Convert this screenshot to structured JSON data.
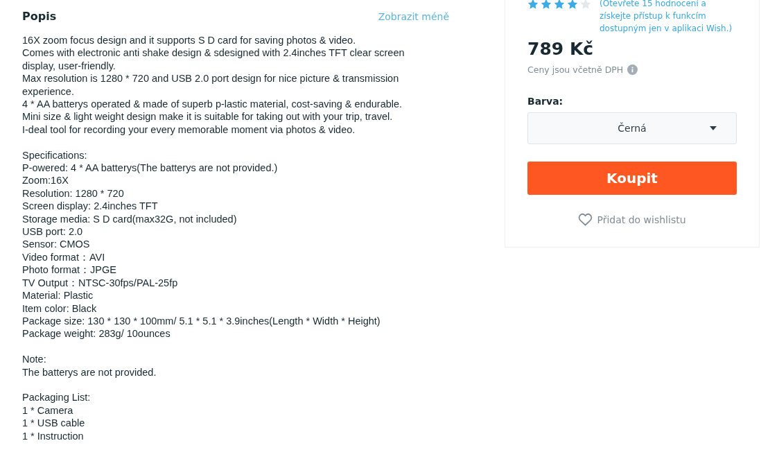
{
  "description": {
    "title": "Popis",
    "toggle_link": "Zobrazit méně",
    "blocks": [
      [
        "16X zoom focus design and it supports S D card for saving photos & video.",
        "Comes with electronic anti shake design & sdesigned with 2.4inches TFT clear screen display, user-friendly.",
        "Max resolution is 1280 * 720 and USB 2.0 port design for nice picture & transmission experience.",
        "4 * AA batterys operated & made of superb p-lastic material, cost-saving & endurable.",
        "Mini size & light weight design make it is suitable for taking out with your trip, travel.",
        "I-deal tool for recording your every memorable moment via photos & video."
      ],
      [
        "Specifications:",
        "P-owered: 4 * AA batterys(The batterys are not provided.)",
        "Zoom:16X",
        "Resolution: 1280 * 720",
        "Screen display: 2.4inches TFT",
        "Storage media: S D card(max32G, not included)",
        "USB port: 2.0",
        "Sensor: CMOS",
        "Video format：AVI",
        "Photo format：JPGE",
        "TV Output：NTSC-30fps/PAL-25fp",
        "Material: Plastic",
        "Item color: Black",
        "Package size: 130 * 130 * 100mm/ 5.1 * 5.1 *  3.9inches(Length * Width * Height)",
        "Package weight: 283g/ 10ounces"
      ],
      [
        "Note:",
        "The batterys are not provided."
      ],
      [
        "Packaging List:",
        "1 * Camera",
        "1 * USB cable",
        "1 * Instruction"
      ]
    ]
  },
  "purchase": {
    "stars": 4,
    "rating_note": "(Otevřete 15 hodnocení a získejte přístup k funkcím dostupným jen v aplikaci Wish.)",
    "price": "789 Kč",
    "vat_note": "Ceny jsou včetně DPH",
    "color_label": "Barva:",
    "color_value": "Černá",
    "buy_button": "Koupit",
    "wishlist_link": "Přidat do wishlistu"
  }
}
